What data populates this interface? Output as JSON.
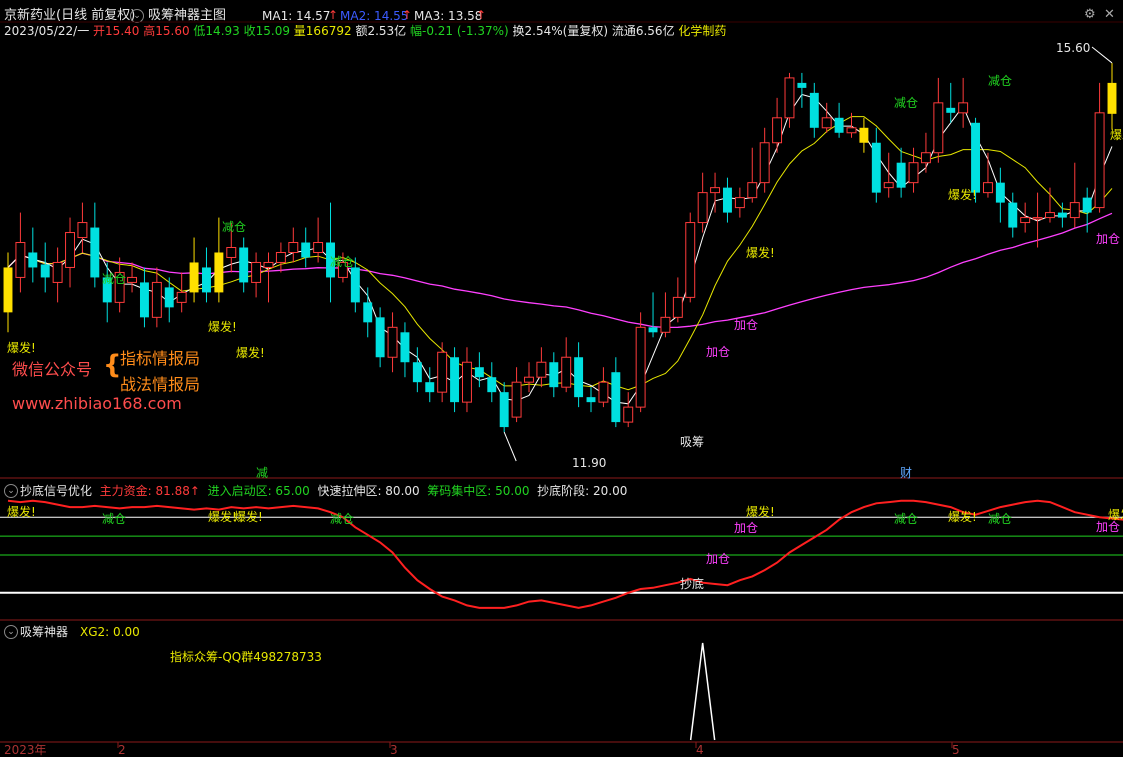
{
  "header": {
    "stock_name": "京新药业(日线 前复权)",
    "indicator_title": "吸筹神器主图",
    "ma1_label": "MA1: 14.57",
    "ma2_label": "MA2: 14.55",
    "ma3_label": "MA3: 13.58",
    "info_date": "2023/05/22/一",
    "info_open": "开15.40",
    "info_high": "高15.60",
    "info_low": "低14.93",
    "info_close": "收15.09",
    "info_volume": "量166792",
    "info_amount": "额2.53亿",
    "info_change": "幅-0.21 (-1.37%)",
    "info_turnover": "换2.54%(量复权)",
    "info_float": "流通6.56亿",
    "info_sector": "化学制药",
    "colors": {
      "up": "#ff3b3b",
      "down": "#00e0e0",
      "ma1": "#ffffff",
      "ma2": "#e8e800",
      "ma3": "#ff40ff"
    }
  },
  "main_chart": {
    "high_label": "15.60",
    "low_label": "11.90",
    "watermark_1": "微信公众号",
    "watermark_2": "指标情报局",
    "watermark_3": "战法情报局",
    "watermark_url": "www.zhibiao168.com",
    "signal_jiancang": "减仓",
    "signal_baofa": "爆发!",
    "signal_jiacang": "加仓",
    "signal_xichou": "吸筹",
    "bottom_marker_1": "减",
    "bottom_marker_2": "财"
  },
  "panel2": {
    "title": "抄底信号优化",
    "zhuli_label": "主力资金: 81.88",
    "jinru_label": "进入启动区: 65.00",
    "kuaisu_label": "快速拉伸区: 80.00",
    "choumu_label": "筹码集中区: 50.00",
    "chaodi_label": "抄底阶段: 20.00",
    "signal_chaodi": "抄底"
  },
  "panel3": {
    "title": "吸筹神器",
    "xg2_label": "XG2: 0.00",
    "note": "指标众筹-QQ群498278733",
    "axis_year": "2023年",
    "axis_m2": "2",
    "axis_m3": "3",
    "axis_m4": "4",
    "axis_m5": "5"
  },
  "chart_data": {
    "type": "candlestick",
    "title": "吸筹神器主图",
    "period_end": "2023/05/22",
    "price_high": 15.6,
    "price_low": 11.9,
    "candles": [
      {
        "o": 13.1,
        "c": 13.55,
        "h": 13.7,
        "l": 12.9
      },
      {
        "o": 13.45,
        "c": 13.8,
        "h": 14.1,
        "l": 13.3
      },
      {
        "o": 13.7,
        "c": 13.55,
        "h": 13.95,
        "l": 13.4
      },
      {
        "o": 13.58,
        "c": 13.45,
        "h": 13.8,
        "l": 13.3
      },
      {
        "o": 13.4,
        "c": 13.6,
        "h": 13.75,
        "l": 13.2
      },
      {
        "o": 13.55,
        "c": 13.9,
        "h": 14.05,
        "l": 13.35
      },
      {
        "o": 13.85,
        "c": 14.0,
        "h": 14.2,
        "l": 13.7
      },
      {
        "o": 13.95,
        "c": 13.45,
        "h": 14.2,
        "l": 13.35
      },
      {
        "o": 13.45,
        "c": 13.2,
        "h": 13.6,
        "l": 13.0
      },
      {
        "o": 13.2,
        "c": 13.5,
        "h": 13.65,
        "l": 13.1
      },
      {
        "o": 13.4,
        "c": 13.45,
        "h": 13.6,
        "l": 13.3
      },
      {
        "o": 13.4,
        "c": 13.05,
        "h": 13.55,
        "l": 12.95
      },
      {
        "o": 13.05,
        "c": 13.4,
        "h": 13.55,
        "l": 12.95
      },
      {
        "o": 13.35,
        "c": 13.15,
        "h": 13.45,
        "l": 13.0
      },
      {
        "o": 13.2,
        "c": 13.3,
        "h": 13.5,
        "l": 13.1
      },
      {
        "o": 13.3,
        "c": 13.6,
        "h": 13.85,
        "l": 13.2
      },
      {
        "o": 13.55,
        "c": 13.3,
        "h": 13.75,
        "l": 13.2
      },
      {
        "o": 13.3,
        "c": 13.7,
        "h": 14.05,
        "l": 13.2
      },
      {
        "o": 13.65,
        "c": 13.75,
        "h": 14.0,
        "l": 13.5
      },
      {
        "o": 13.75,
        "c": 13.4,
        "h": 13.85,
        "l": 13.3
      },
      {
        "o": 13.4,
        "c": 13.6,
        "h": 13.7,
        "l": 13.25
      },
      {
        "o": 13.55,
        "c": 13.6,
        "h": 13.7,
        "l": 13.2
      },
      {
        "o": 13.6,
        "c": 13.7,
        "h": 13.8,
        "l": 13.5
      },
      {
        "o": 13.7,
        "c": 13.8,
        "h": 13.95,
        "l": 13.6
      },
      {
        "o": 13.8,
        "c": 13.65,
        "h": 13.95,
        "l": 13.55
      },
      {
        "o": 13.7,
        "c": 13.8,
        "h": 14.05,
        "l": 13.6
      },
      {
        "o": 13.8,
        "c": 13.45,
        "h": 14.2,
        "l": 13.2
      },
      {
        "o": 13.45,
        "c": 13.6,
        "h": 13.7,
        "l": 13.4
      },
      {
        "o": 13.55,
        "c": 13.2,
        "h": 13.65,
        "l": 13.1
      },
      {
        "o": 13.2,
        "c": 13.0,
        "h": 13.35,
        "l": 12.85
      },
      {
        "o": 13.05,
        "c": 12.65,
        "h": 13.15,
        "l": 12.55
      },
      {
        "o": 12.65,
        "c": 12.95,
        "h": 13.1,
        "l": 12.5
      },
      {
        "o": 12.9,
        "c": 12.6,
        "h": 13.0,
        "l": 12.45
      },
      {
        "o": 12.6,
        "c": 12.4,
        "h": 12.75,
        "l": 12.3
      },
      {
        "o": 12.4,
        "c": 12.3,
        "h": 12.55,
        "l": 12.2
      },
      {
        "o": 12.3,
        "c": 12.7,
        "h": 12.8,
        "l": 12.2
      },
      {
        "o": 12.65,
        "c": 12.2,
        "h": 12.75,
        "l": 12.1
      },
      {
        "o": 12.2,
        "c": 12.6,
        "h": 12.75,
        "l": 12.1
      },
      {
        "o": 12.55,
        "c": 12.45,
        "h": 12.7,
        "l": 12.35
      },
      {
        "o": 12.45,
        "c": 12.3,
        "h": 12.6,
        "l": 12.2
      },
      {
        "o": 12.3,
        "c": 11.95,
        "h": 12.4,
        "l": 11.9
      },
      {
        "o": 12.05,
        "c": 12.4,
        "h": 12.55,
        "l": 12.0
      },
      {
        "o": 12.4,
        "c": 12.45,
        "h": 12.6,
        "l": 12.3
      },
      {
        "o": 12.45,
        "c": 12.6,
        "h": 12.75,
        "l": 12.35
      },
      {
        "o": 12.6,
        "c": 12.35,
        "h": 12.7,
        "l": 12.25
      },
      {
        "o": 12.35,
        "c": 12.65,
        "h": 12.85,
        "l": 12.3
      },
      {
        "o": 12.65,
        "c": 12.25,
        "h": 12.8,
        "l": 12.15
      },
      {
        "o": 12.25,
        "c": 12.2,
        "h": 12.35,
        "l": 12.1
      },
      {
        "o": 12.2,
        "c": 12.4,
        "h": 12.55,
        "l": 12.15
      },
      {
        "o": 12.5,
        "c": 12.0,
        "h": 12.65,
        "l": 11.95
      },
      {
        "o": 12.0,
        "c": 12.15,
        "h": 12.3,
        "l": 11.95
      },
      {
        "o": 12.15,
        "c": 12.95,
        "h": 13.1,
        "l": 12.1
      },
      {
        "o": 12.95,
        "c": 12.9,
        "h": 13.3,
        "l": 12.85
      },
      {
        "o": 12.9,
        "c": 13.05,
        "h": 13.3,
        "l": 12.85
      },
      {
        "o": 13.05,
        "c": 13.25,
        "h": 13.45,
        "l": 13.0
      },
      {
        "o": 13.25,
        "c": 14.0,
        "h": 14.1,
        "l": 13.2
      },
      {
        "o": 14.0,
        "c": 14.3,
        "h": 14.5,
        "l": 13.9
      },
      {
        "o": 14.3,
        "c": 14.35,
        "h": 14.5,
        "l": 14.1
      },
      {
        "o": 14.35,
        "c": 14.1,
        "h": 14.45,
        "l": 14.0
      },
      {
        "o": 14.15,
        "c": 14.25,
        "h": 14.35,
        "l": 14.05
      },
      {
        "o": 14.25,
        "c": 14.4,
        "h": 14.75,
        "l": 14.2
      },
      {
        "o": 14.4,
        "c": 14.8,
        "h": 14.95,
        "l": 14.3
      },
      {
        "o": 14.8,
        "c": 15.05,
        "h": 15.25,
        "l": 14.7
      },
      {
        "o": 15.05,
        "c": 15.45,
        "h": 15.5,
        "l": 14.95
      },
      {
        "o": 15.4,
        "c": 15.35,
        "h": 15.5,
        "l": 15.15
      },
      {
        "o": 15.3,
        "c": 14.95,
        "h": 15.4,
        "l": 14.85
      },
      {
        "o": 14.95,
        "c": 15.05,
        "h": 15.2,
        "l": 14.9
      },
      {
        "o": 15.05,
        "c": 14.9,
        "h": 15.2,
        "l": 14.85
      },
      {
        "o": 14.9,
        "c": 14.95,
        "h": 15.1,
        "l": 14.85
      },
      {
        "o": 14.95,
        "c": 14.8,
        "h": 15.05,
        "l": 14.7
      },
      {
        "o": 14.8,
        "c": 14.3,
        "h": 14.95,
        "l": 14.2
      },
      {
        "o": 14.35,
        "c": 14.4,
        "h": 14.7,
        "l": 14.25
      },
      {
        "o": 14.6,
        "c": 14.35,
        "h": 14.75,
        "l": 14.25
      },
      {
        "o": 14.4,
        "c": 14.6,
        "h": 14.75,
        "l": 14.3
      },
      {
        "o": 14.6,
        "c": 14.7,
        "h": 14.9,
        "l": 14.5
      },
      {
        "o": 14.7,
        "c": 15.2,
        "h": 15.45,
        "l": 14.6
      },
      {
        "o": 15.15,
        "c": 15.1,
        "h": 15.4,
        "l": 15.0
      },
      {
        "o": 15.1,
        "c": 15.2,
        "h": 15.45,
        "l": 14.95
      },
      {
        "o": 15.0,
        "c": 14.3,
        "h": 15.05,
        "l": 14.2
      },
      {
        "o": 14.3,
        "c": 14.4,
        "h": 14.7,
        "l": 14.25
      },
      {
        "o": 14.4,
        "c": 14.2,
        "h": 14.55,
        "l": 14.0
      },
      {
        "o": 14.2,
        "c": 13.95,
        "h": 14.3,
        "l": 13.85
      },
      {
        "o": 14.0,
        "c": 14.05,
        "h": 14.2,
        "l": 13.9
      },
      {
        "o": 14.05,
        "c": 14.05,
        "h": 14.3,
        "l": 13.75
      },
      {
        "o": 14.05,
        "c": 14.1,
        "h": 14.35,
        "l": 14.0
      },
      {
        "o": 14.1,
        "c": 14.05,
        "h": 14.2,
        "l": 13.95
      },
      {
        "o": 14.05,
        "c": 14.2,
        "h": 14.6,
        "l": 13.95
      },
      {
        "o": 14.25,
        "c": 14.1,
        "h": 14.35,
        "l": 13.9
      },
      {
        "o": 14.15,
        "c": 15.1,
        "h": 15.4,
        "l": 14.1
      },
      {
        "o": 15.4,
        "c": 15.09,
        "h": 15.6,
        "l": 14.93
      }
    ],
    "yellow_candles": [
      0,
      15,
      17,
      69,
      89
    ],
    "signal_series": [
      93,
      92,
      93,
      92,
      90,
      88,
      88,
      89,
      88,
      87,
      88,
      88,
      89,
      88,
      87,
      86,
      87,
      86,
      88,
      87,
      88,
      87,
      88,
      89,
      88,
      87,
      84,
      80,
      72,
      66,
      60,
      52,
      40,
      30,
      23,
      17,
      14,
      10,
      8,
      8,
      8,
      10,
      13,
      14,
      12,
      10,
      8,
      10,
      13,
      16,
      20,
      23,
      24,
      26,
      28,
      31,
      28,
      27,
      26,
      30,
      33,
      38,
      44,
      52,
      58,
      64,
      70,
      78,
      84,
      88,
      91,
      92,
      93,
      93,
      92,
      90,
      88,
      84,
      82,
      85,
      88,
      90,
      92,
      93,
      92,
      88,
      84,
      82,
      80,
      79,
      78,
      79,
      80,
      83,
      86
    ],
    "xg2_spike_index": 56
  }
}
